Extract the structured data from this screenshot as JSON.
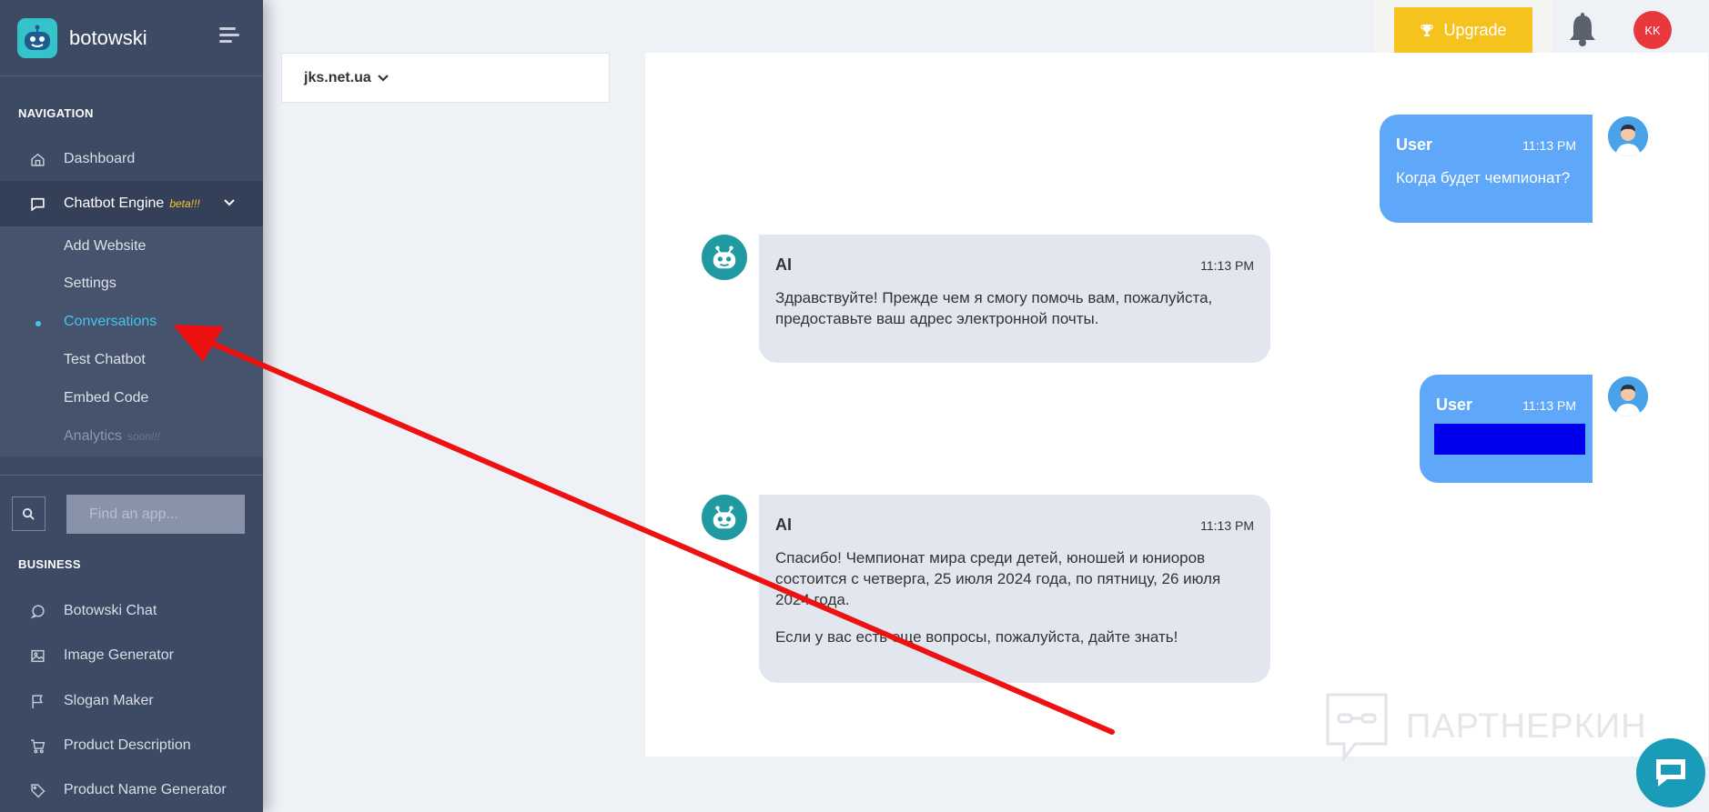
{
  "brand": {
    "name": "botowski"
  },
  "nav": {
    "section_label": "NAVIGATION",
    "dashboard": "Dashboard",
    "chatbot_engine": "Chatbot Engine",
    "chatbot_badge": "beta!!!",
    "submenu": [
      {
        "label": "Add Website"
      },
      {
        "label": "Settings"
      },
      {
        "label": "Conversations"
      },
      {
        "label": "Test Chatbot"
      },
      {
        "label": "Embed Code"
      },
      {
        "label": "Analytics"
      }
    ],
    "analytics_badge": "soon!!!"
  },
  "search": {
    "placeholder": "Find an app..."
  },
  "business": {
    "section_label": "BUSINESS",
    "items": [
      {
        "label": "Botowski Chat",
        "icon": "chat-bubble-icon"
      },
      {
        "label": "Image Generator",
        "icon": "image-icon"
      },
      {
        "label": "Slogan Maker",
        "icon": "flag-icon"
      },
      {
        "label": "Product Description",
        "icon": "cart-icon"
      },
      {
        "label": "Product Name Generator",
        "icon": "tag-icon"
      }
    ]
  },
  "topbar": {
    "upgrade_label": "Upgrade",
    "avatar_initials": "KK"
  },
  "site_selector": {
    "value": "jks.net.ua"
  },
  "messages": [
    {
      "role": "user",
      "name": "User",
      "time": "11:13 PM",
      "text": "Когда будет чемпионат?"
    },
    {
      "role": "ai",
      "name": "AI",
      "time": "11:13 PM",
      "text": "Здравствуйте! Прежде чем я смогу помочь вам, пожалуйста, предоставьте ваш адрес электронной почты."
    },
    {
      "role": "user",
      "name": "User",
      "time": "11:13 PM",
      "text": ""
    },
    {
      "role": "ai",
      "name": "AI",
      "time": "11:13 PM",
      "text": "Спасибо! Чемпионат мира среди детей, юношей и юниоров состоится с четверга, 25 июля 2024 года, по пятницу, 26 июля 2024 года.",
      "text2": "Если у вас есть еще вопросы, пожалуйста, дайте знать!"
    }
  ],
  "watermark": "ПАРТНЕРКИН",
  "colors": {
    "sidebar": "#3d4a63",
    "accent": "#41c6f0",
    "user_bubble": "#5fa7f8",
    "ai_bubble": "#e2e6ef",
    "upgrade": "#f6c21d",
    "annotation_arrow": "#ee1111"
  }
}
